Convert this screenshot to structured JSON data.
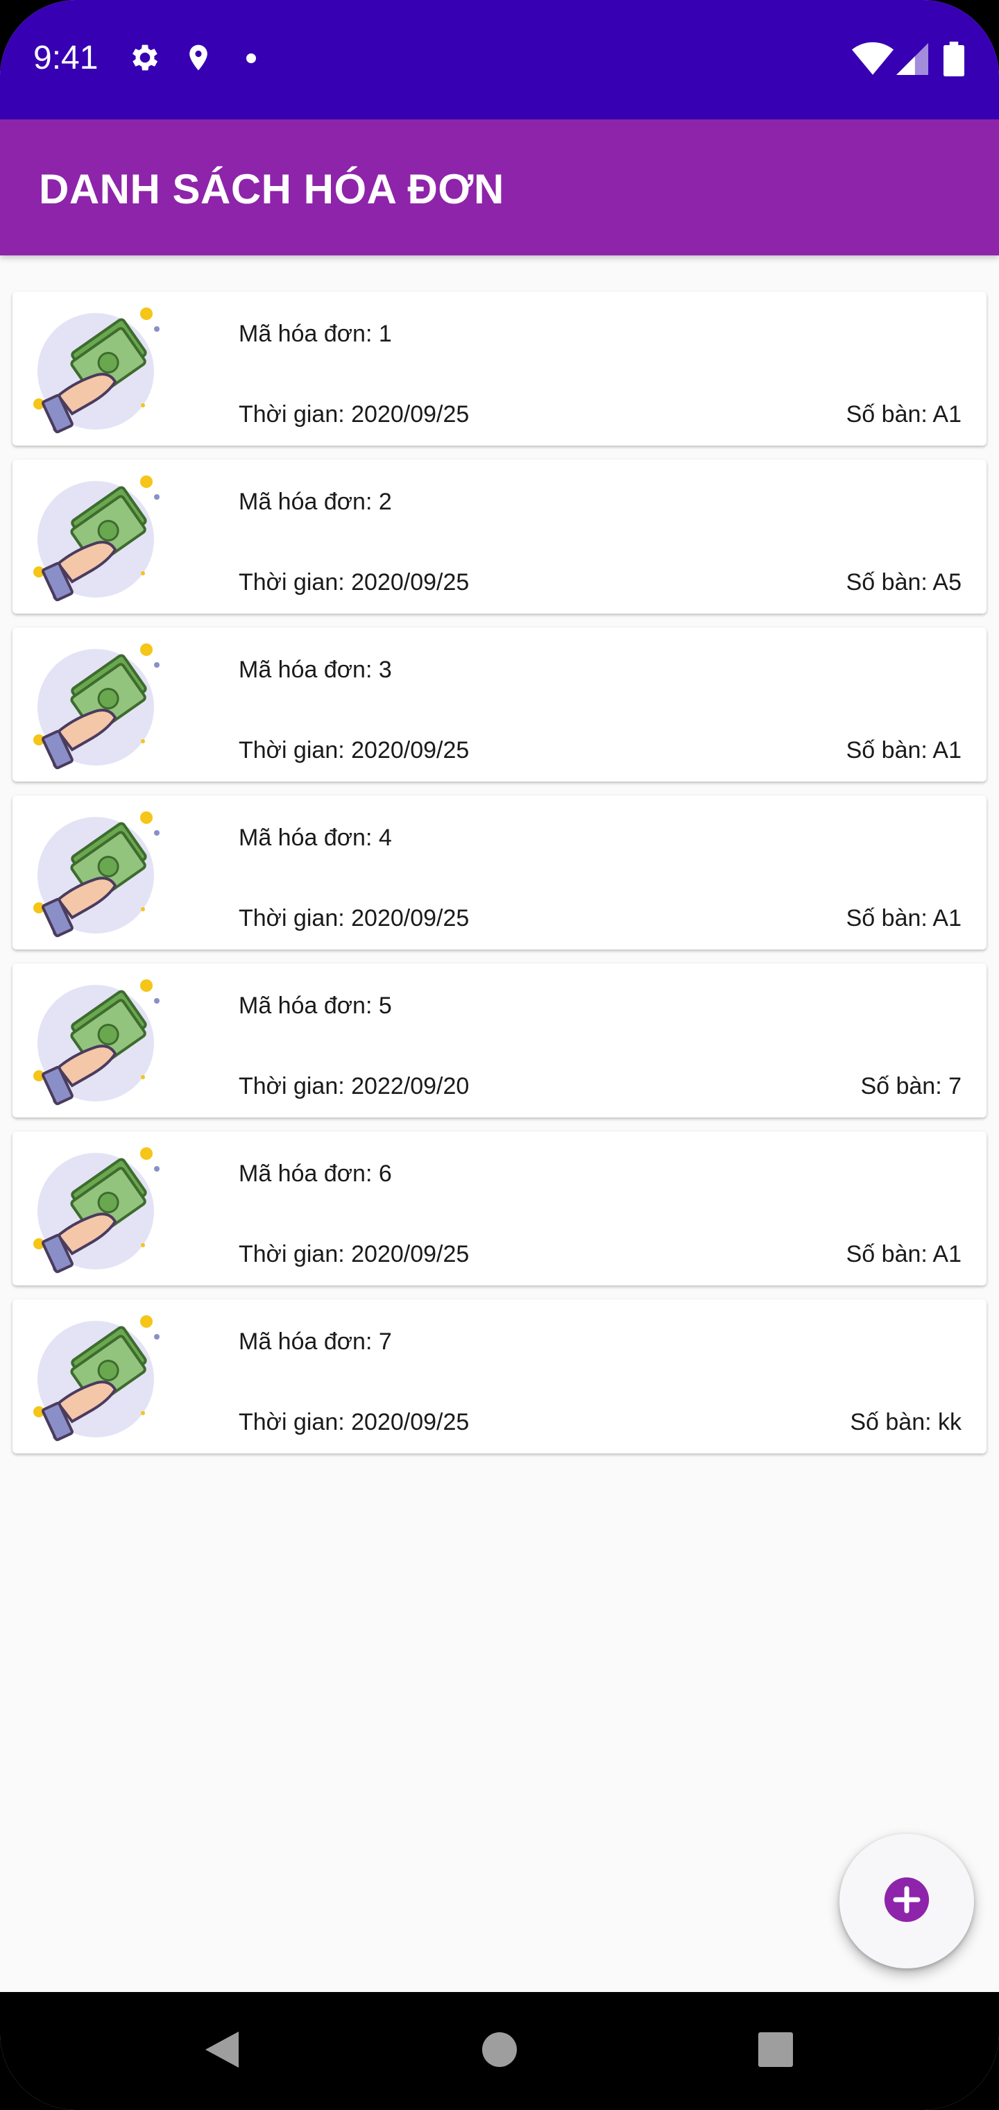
{
  "status_bar": {
    "time": "9:41",
    "icons_left": [
      "gear-icon",
      "location-pin-icon",
      "dot-icon"
    ],
    "icons_right": [
      "wifi-icon",
      "cellular-signal-icon",
      "battery-icon"
    ],
    "background": "#3700b3"
  },
  "app_bar": {
    "title": "DANH SÁCH HÓA ĐƠN",
    "background": "#8e24aa"
  },
  "invoices": [
    {
      "id_label": "Mã hóa đơn: 1",
      "time_label": "Thời gian: 2020/09/25",
      "table_label": "Số bàn: A1"
    },
    {
      "id_label": "Mã hóa đơn: 2",
      "time_label": "Thời gian: 2020/09/25",
      "table_label": "Số bàn: A5"
    },
    {
      "id_label": "Mã hóa đơn: 3",
      "time_label": "Thời gian: 2020/09/25",
      "table_label": "Số bàn: A1"
    },
    {
      "id_label": "Mã hóa đơn: 4",
      "time_label": "Thời gian: 2020/09/25",
      "table_label": "Số bàn: A1"
    },
    {
      "id_label": "Mã hóa đơn: 5",
      "time_label": "Thời gian: 2022/09/20",
      "table_label": "Số bàn: 7"
    },
    {
      "id_label": "Mã hóa đơn: 6",
      "time_label": "Thời gian: 2020/09/25",
      "table_label": "Số bàn: A1"
    },
    {
      "id_label": "Mã hóa đơn: 7",
      "time_label": "Thời gian: 2020/09/25",
      "table_label": "Số bàn: kk"
    }
  ],
  "fab": {
    "icon": "add-icon",
    "accent": "#8e24aa"
  },
  "nav_bar": {
    "buttons": [
      "back-icon",
      "home-icon",
      "recents-icon"
    ]
  }
}
